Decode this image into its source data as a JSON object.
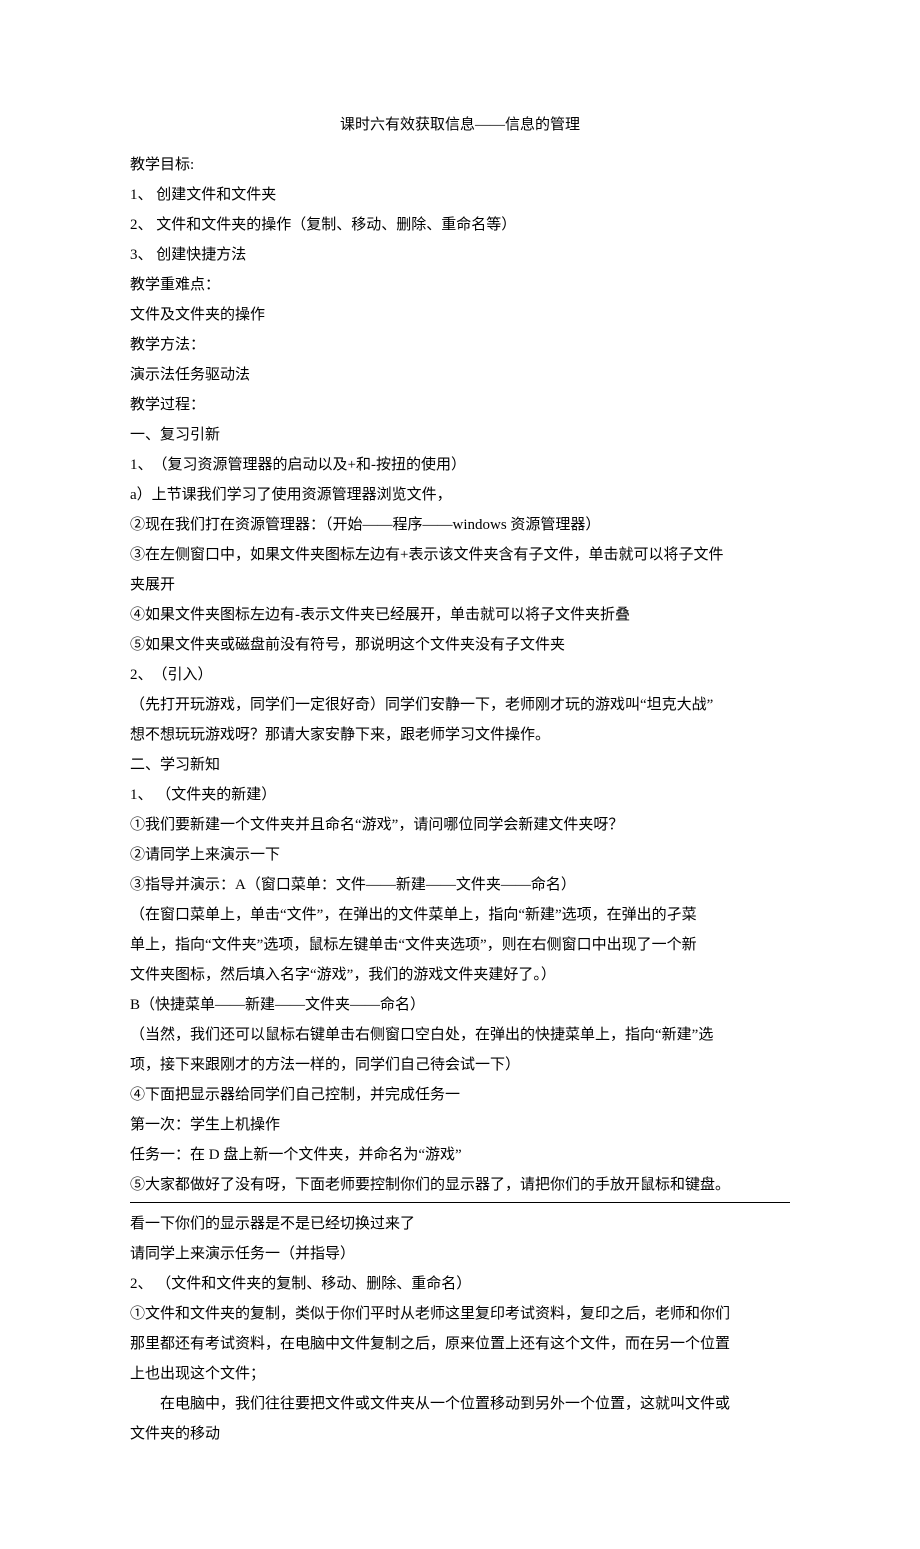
{
  "title": "课时六有效获取信息——信息的管理",
  "lines": {
    "l1": "教学目标:",
    "l2": "1、 创建文件和文件夹",
    "l3": "2、 文件和文件夹的操作（复制、移动、删除、重命名等）",
    "l4": "3、 创建快捷方法",
    "l5": "教学重难点：",
    "l6": "文件及文件夹的操作",
    "l7": "教学方法：",
    "l8": "演示法任务驱动法",
    "l9": "教学过程：",
    "l10": "一、复习引新",
    "l11": "1、　（复习资源管理器的启动以及+和-按扭的使用）",
    "l12": "a）上节课我们学习了使用资源管理器浏览文件，",
    "l13": "②现在我们打在资源管理器：（开始——程序——windows 资源管理器）",
    "l14": "③在左侧窗口中，如果文件夹图标左边有+表示该文件夹含有子文件，单击就可以将子文件",
    "l14b": "夹展开",
    "l15": "④如果文件夹图标左边有-表示文件夹已经展开，单击就可以将子文件夹折叠",
    "l16": "⑤如果文件夹或磁盘前没有符号，那说明这个文件夹没有子文件夹",
    "l17": "2、　（引入）",
    "l18": "（先打开玩游戏，同学们一定很好奇）同学们安静一下，老师刚才玩的游戏叫“坦克大战”",
    "l18b": "想不想玩玩游戏呀？那请大家安静下来，跟老师学习文件操作。",
    "l19": "二、学习新知",
    "l20": "1、 （文件夹的新建）",
    "l21": "①我们要新建一个文件夹并且命名“游戏”，请问哪位同学会新建文件夹呀？",
    "l22": "②请同学上来演示一下",
    "l23": "③指导并演示：A（窗口菜单：文件――新建――文件夹――命名）",
    "l24": "（在窗口菜单上，单击“文件”，在弹出的文件菜单上，指向“新建”选项，在弹出的孑菜",
    "l24b": "单上，指向“文件夹”选项，鼠标左键单击“文件夹选项”，则在右侧窗口中出现了一个新",
    "l24c": "文件夹图标，然后填入名字“游戏”，我们的游戏文件夹建好了。）",
    "l25": "B（快捷菜单――新建――文件夹――命名）",
    "l26": "（当然，我们还可以鼠标右键单击右侧窗口空白处，在弹出的快捷菜单上，指向“新建”选",
    "l26b": "项，接下来跟刚才的方法一样的，同学们自己待会试一下）",
    "l27": "④下面把显示器给同学们自己控制，并完成任务一",
    "l28": "第一次：学生上机操作",
    "l29": "任务一：在 D 盘上新一个文件夹，并命名为“游戏”",
    "l30": "⑤大家都做好了没有呀，下面老师要控制你们的显示器了，请把你们的手放开鼠标和键盘。",
    "l31": "看一下你们的显示器是不是已经切换过来了",
    "l32": "请同学上来演示任务一（并指导）",
    "l33": "2、 （文件和文件夹的复制、移动、删除、重命名）",
    "l34": "①文件和文件夹的复制，类似于你们平时从老师这里复印考试资料，复印之后，老师和你们",
    "l34b": "那里都还有考试资料，在电脑中文件复制之后，原来位置上还有这个文件，而在另一个位置",
    "l34c": "上也出现这个文件；",
    "l35": "在电脑中，我们往往要把文件或文件夹从一个位置移动到另外一个位置，这就叫文件或",
    "l35b": "文件夹的移动"
  }
}
